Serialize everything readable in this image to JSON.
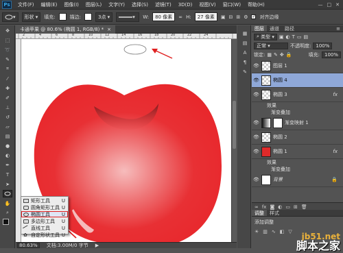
{
  "menubar": {
    "logo": "Ps",
    "items": [
      "文件(F)",
      "编辑(E)",
      "图像(I)",
      "图层(L)",
      "文字(Y)",
      "选择(S)",
      "滤镜(T)",
      "3D(D)",
      "视图(V)",
      "窗口(W)",
      "帮助(H)"
    ],
    "win_min": "—",
    "win_max": "□",
    "win_close": "✕"
  },
  "options": {
    "mode": "形状",
    "fill_label": "填充:",
    "stroke_label": "描边:",
    "stroke_width": "3点",
    "w_label": "W:",
    "w_value": "80 像素",
    "h_label": "H:",
    "h_value": "27 像素",
    "align_label": "对齐边缘",
    "fill_color": "#ffffff",
    "stroke_color": "#ffffff"
  },
  "document": {
    "tab_title": "卡通苹果 @ 80.6% (椭圆 1, RGB/8) *",
    "tab_close": "×",
    "ruler_ticks": [
      "2",
      "4",
      "6",
      "8",
      "10",
      "12",
      "14",
      "16",
      "18",
      "20",
      "22",
      "24"
    ],
    "zoom": "80.63%",
    "doc_info": "文档:3.00M/0 字节",
    "status_arrow": "▶"
  },
  "flyout": {
    "items": [
      {
        "label": "矩形工具",
        "key": "U"
      },
      {
        "label": "圆角矩形工具",
        "key": "U"
      },
      {
        "label": "椭圆工具",
        "key": "U"
      },
      {
        "label": "多边形工具",
        "key": "U"
      },
      {
        "label": "直线工具",
        "key": "U"
      },
      {
        "label": "自定形状工具",
        "key": "U"
      }
    ]
  },
  "panels": {
    "tabs": [
      "图层",
      "通道",
      "路径"
    ],
    "kind_label": "类型",
    "blend_mode": "正常",
    "opacity_label": "不透明度:",
    "opacity_value": "100%",
    "lock_label": "锁定:",
    "fill_label": "填充:",
    "fill_value": "100%",
    "layers": [
      {
        "name": "图层 1"
      },
      {
        "name": "椭圆 4"
      },
      {
        "name": "椭圆 3"
      },
      {
        "name": "效果"
      },
      {
        "name": "渐变叠加"
      },
      {
        "name": "渐变映射 1"
      },
      {
        "name": "椭圆 2"
      },
      {
        "name": "椭圆 1"
      },
      {
        "name": "效果"
      },
      {
        "name": "渐变叠加"
      },
      {
        "name": "背景"
      }
    ],
    "bottom_tabs": [
      "调整",
      "样式"
    ],
    "adjust_label": "添加调整"
  },
  "watermark": {
    "site": "jb51.net",
    "name": "脚本之家"
  },
  "colors": {
    "apple_red": "#e8262b",
    "selected_layer": "#8fa8d8",
    "annotation_red": "#e02020"
  }
}
